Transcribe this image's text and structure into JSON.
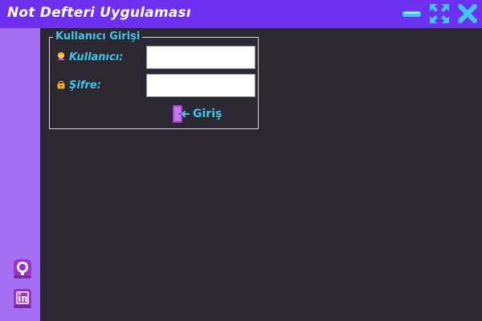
{
  "window": {
    "title": "Not Defteri Uygulaması",
    "controls": {
      "minimize": "minimize-icon",
      "maximize": "maximize-icon",
      "close": "close-icon"
    }
  },
  "sidebar": {
    "items": [
      {
        "icon": "github-icon"
      },
      {
        "icon": "linkedin-icon"
      }
    ]
  },
  "login": {
    "group_title": "Kullanıcı Girişi",
    "username_label": "Kullanıcı:",
    "username_value": "",
    "password_label": "Şifre:",
    "password_value": "",
    "submit_label": "Giriş",
    "submit_icon": "door-exit-icon"
  },
  "colors": {
    "titlebar": "#6d2ff0",
    "sidebar": "#a46ff2",
    "background": "#2b2831",
    "accent": "#3ec6ec"
  }
}
